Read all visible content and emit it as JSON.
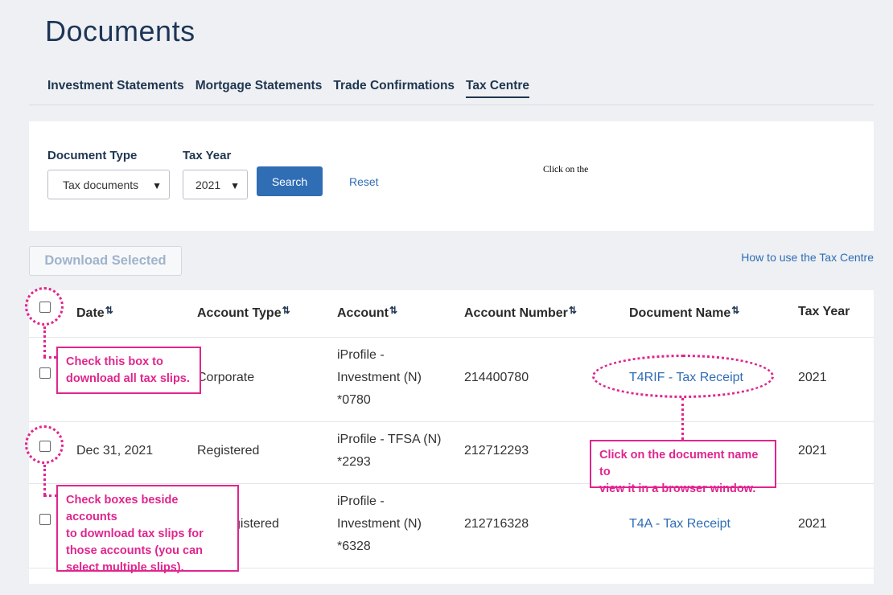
{
  "page": {
    "title": "Documents"
  },
  "tabs": [
    {
      "label": "Investment Statements",
      "active": false
    },
    {
      "label": "Mortgage Statements",
      "active": false
    },
    {
      "label": "Trade Confirmations",
      "active": false
    },
    {
      "label": "Tax Centre",
      "active": true
    }
  ],
  "filters": {
    "document_type_label": "Document Type",
    "document_type_value": "Tax documents",
    "tax_year_label": "Tax Year",
    "tax_year_value": "2021",
    "search_label": "Search",
    "reset_label": "Reset",
    "stray_text": "Click on the"
  },
  "actions": {
    "download_selected_label": "Download Selected",
    "how_to_link": "How to use the Tax Centre"
  },
  "table": {
    "columns": [
      "Date",
      "Account Type",
      "Account",
      "Account Number",
      "Document Name",
      "Tax Year"
    ],
    "sort_icon": "⇅",
    "rows": [
      {
        "date": "",
        "account_type": "Corporate",
        "account_lines": [
          "iProfile -",
          "Investment (N)",
          "*0780"
        ],
        "account_number": "214400780",
        "document_name": "T4RIF - Tax Receipt",
        "tax_year": "2021"
      },
      {
        "date": "Dec 31, 2021",
        "account_type": "Registered",
        "account_lines": [
          "iProfile - TFSA (N)",
          "*2293"
        ],
        "account_number": "212712293",
        "document_name": "",
        "tax_year": "2021"
      },
      {
        "date": "",
        "account_type": "gistered",
        "account_lines": [
          "iProfile -",
          "Investment (N)",
          "*6328"
        ],
        "account_number": "212716328",
        "document_name": "T4A - Tax Receipt",
        "tax_year": "2021"
      }
    ]
  },
  "annotations": {
    "select_all_lines": [
      "Check this box to",
      "download all tax slips."
    ],
    "select_rows_lines": [
      "Check boxes beside accounts",
      "to download tax slips for",
      "those accounts (you can",
      "select multiple slips)."
    ],
    "doc_name_lines": [
      "Click on the document name to",
      "view it in a browser window."
    ]
  },
  "colors": {
    "accent": "#2f6db5",
    "heading": "#1f3550",
    "annotation": "#e0258e"
  }
}
